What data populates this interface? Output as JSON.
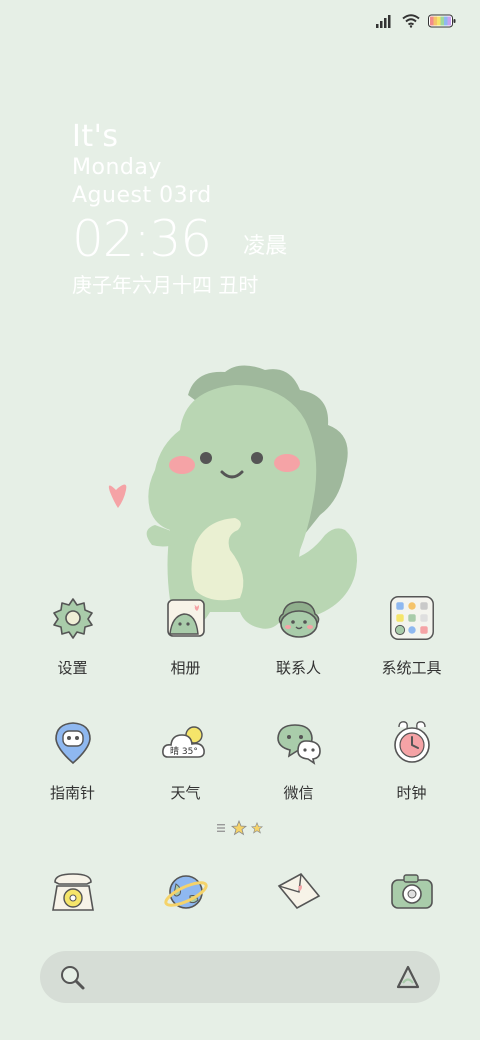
{
  "status_bar": {
    "icons": [
      "signal-icon",
      "wifi-icon",
      "battery-icon"
    ]
  },
  "clock": {
    "line1": "It's",
    "line2": "Monday",
    "line3": "Aguest 03rd",
    "time": "02:36",
    "period": "凌晨",
    "lunar": "庚子年六月十四 丑时"
  },
  "apps_row1": [
    {
      "label": "设置",
      "icon": "gear-icon"
    },
    {
      "label": "相册",
      "icon": "gallery-icon"
    },
    {
      "label": "联系人",
      "icon": "contacts-icon"
    },
    {
      "label": "系统工具",
      "icon": "system-tools-folder-icon"
    }
  ],
  "apps_row2": [
    {
      "label": "指南针",
      "icon": "compass-icon"
    },
    {
      "label": "天气",
      "icon": "weather-icon",
      "badge": "晴 35°"
    },
    {
      "label": "微信",
      "icon": "wechat-icon"
    },
    {
      "label": "时钟",
      "icon": "clock-icon"
    }
  ],
  "dock": [
    {
      "icon": "phone-icon"
    },
    {
      "icon": "browser-icon"
    },
    {
      "icon": "message-icon"
    },
    {
      "icon": "camera-icon"
    }
  ],
  "page_indicator": {
    "pages": 3,
    "current": 2
  },
  "colors": {
    "background": "#e6efe6",
    "dino": "#b9d6b3",
    "accent_pink": "#f5a3a6",
    "icon_green": "#a9ccaa",
    "icon_outline": "#555555"
  }
}
